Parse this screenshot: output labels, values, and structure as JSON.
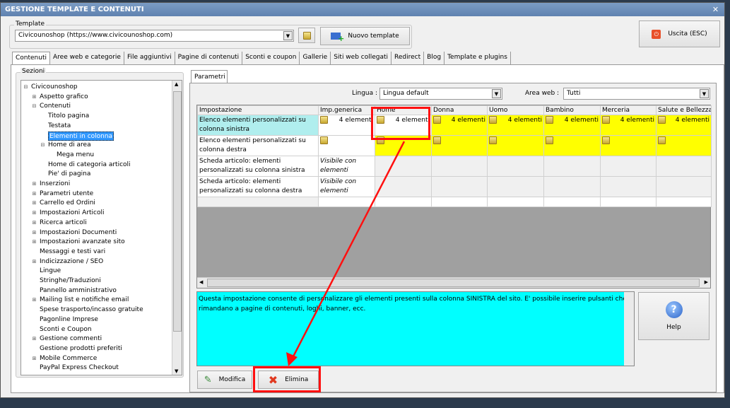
{
  "window": {
    "title": "GESTIONE TEMPLATE E CONTENUTI"
  },
  "template": {
    "group_label": "Template",
    "selected": "Civicounoshop (https://www.civicounoshop.com)",
    "new_button": "Nuovo template",
    "exit_button": "Uscita (ESC)"
  },
  "tabs": [
    "Contenuti",
    "Aree web e categorie",
    "File aggiuntivi",
    "Pagine di contenuti",
    "Sconti e coupon",
    "Gallerie",
    "Siti web collegati",
    "Redirect",
    "Blog",
    "Template e plugins"
  ],
  "sections": {
    "label": "Sezioni",
    "items": [
      {
        "label": "Civicounoshop",
        "level": 0,
        "toggle": "-"
      },
      {
        "label": "Aspetto grafico",
        "level": 1,
        "toggle": "+"
      },
      {
        "label": "Contenuti",
        "level": 1,
        "toggle": "-"
      },
      {
        "label": "Titolo pagina",
        "level": 2
      },
      {
        "label": "Testata",
        "level": 2
      },
      {
        "label": "Elementi in colonna",
        "level": 2,
        "selected": true
      },
      {
        "label": "Home di area",
        "level": 2,
        "toggle": "-"
      },
      {
        "label": "Mega menu",
        "level": 3
      },
      {
        "label": "Home di categoria articoli",
        "level": 2
      },
      {
        "label": "Pie' di pagina",
        "level": 2
      },
      {
        "label": "Inserzioni",
        "level": 1,
        "toggle": "+"
      },
      {
        "label": "Parametri utente",
        "level": 1,
        "toggle": "+"
      },
      {
        "label": "Carrello ed Ordini",
        "level": 1,
        "toggle": "+"
      },
      {
        "label": "Impostazioni Articoli",
        "level": 1,
        "toggle": "+"
      },
      {
        "label": "Ricerca articoli",
        "level": 1,
        "toggle": "+"
      },
      {
        "label": "Impostazioni Documenti",
        "level": 1,
        "toggle": "+"
      },
      {
        "label": "Impostazioni avanzate sito",
        "level": 1,
        "toggle": "+"
      },
      {
        "label": "Messaggi e testi vari",
        "level": 1
      },
      {
        "label": "Indicizzazione / SEO",
        "level": 1,
        "toggle": "+"
      },
      {
        "label": "Lingue",
        "level": 1
      },
      {
        "label": "Stringhe/Traduzioni",
        "level": 1
      },
      {
        "label": "Pannello amministrativo",
        "level": 1
      },
      {
        "label": "Mailing list e notifiche email",
        "level": 1,
        "toggle": "+"
      },
      {
        "label": "Spese trasporto/incasso gratuite",
        "level": 1
      },
      {
        "label": "Pagonline Imprese",
        "level": 1
      },
      {
        "label": "Sconti e Coupon",
        "level": 1
      },
      {
        "label": "Gestione commenti",
        "level": 1,
        "toggle": "+"
      },
      {
        "label": "Gestione prodotti preferiti",
        "level": 1
      },
      {
        "label": "Mobile Commerce",
        "level": 1,
        "toggle": "+"
      },
      {
        "label": "PayPal Express Checkout",
        "level": 1
      }
    ]
  },
  "params": {
    "tab": "Parametri",
    "lingua_label": "Lingua :",
    "lingua_value": "Lingua default",
    "area_label": "Area web :",
    "area_value": "Tutti"
  },
  "grid": {
    "columns": [
      "Impostazione",
      "Imp.generica",
      "Home",
      "Donna",
      "Uomo",
      "Bambino",
      "Merceria",
      "Salute e Bellezza"
    ],
    "rows": [
      {
        "label": "Elenco elementi personalizzati su colonna sinistra",
        "cells": [
          "4 elementi",
          "4 elementi",
          "4 elementi",
          "4 elementi",
          "4 elementi",
          "4 elementi",
          "4 elementi"
        ]
      },
      {
        "label": "Elenco elementi personalizzati su colonna destra",
        "cells": [
          "",
          "",
          "",
          "",
          "",
          "",
          ""
        ]
      },
      {
        "label": "Scheda articolo: elementi personalizzati su colonna sinistra",
        "cells": [
          "Visibile con elementi perso..."
        ]
      },
      {
        "label": "Scheda articolo: elementi personalizzati su colonna destra",
        "cells": [
          "Visibile con elementi perso..."
        ]
      }
    ]
  },
  "description": "Questa impostazione consente di personalizzare gli elementi presenti sulla colonna SINISTRA del sito. E' possibile inserire pulsanti che rimandano a pagine di contenuti, loghi, banner, ecc.",
  "buttons": {
    "help": "Help",
    "modify": "Modifica",
    "delete": "Elimina"
  },
  "colors": {
    "highlight": "#ff1010",
    "yellow_cell": "#ffff00",
    "selected_row": "#b0eeee",
    "description_bg": "#00ffff"
  }
}
